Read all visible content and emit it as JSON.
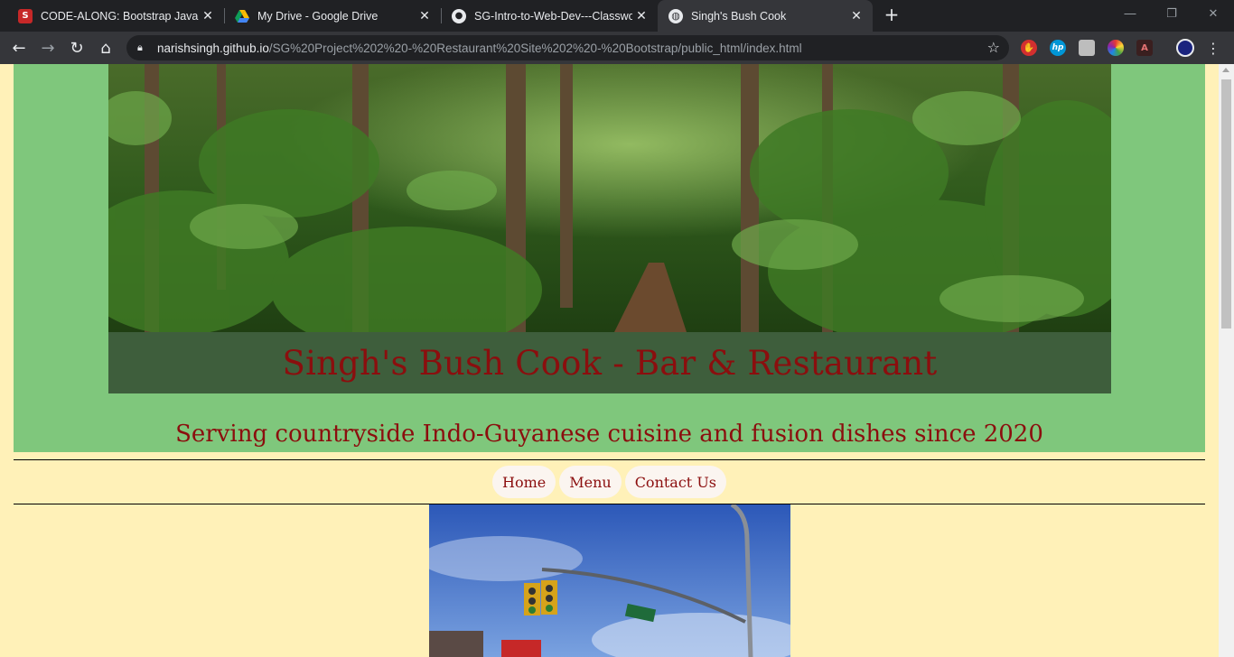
{
  "browser": {
    "tabs": [
      {
        "title": "CODE-ALONG: Bootstrap JavaScri",
        "favicon": "code-along-icon",
        "active": false
      },
      {
        "title": "My Drive - Google Drive",
        "favicon": "google-drive-icon",
        "active": false
      },
      {
        "title": "SG-Intro-to-Web-Dev---Classwor",
        "favicon": "github-icon",
        "active": false
      },
      {
        "title": "Singh's Bush Cook",
        "favicon": "globe-icon",
        "active": true
      }
    ],
    "url_host": "narishsingh.github.io",
    "url_path": "/SG%20Project%202%20-%20Restaurant%20Site%202%20-%20Bootstrap/public_html/index.html",
    "extensions": [
      "adblock-icon",
      "hp-icon",
      "cube-icon",
      "color-wheel-icon",
      "pdf-icon",
      "profile-avatar"
    ]
  },
  "page": {
    "restaurant_name": "Singh's Bush Cook - Bar & Restaurant",
    "tagline": "Serving countryside Indo-Guyanese cuisine and fusion dishes since 2020",
    "nav": [
      {
        "label": "Home"
      },
      {
        "label": "Menu"
      },
      {
        "label": "Contact Us"
      }
    ]
  },
  "colors": {
    "page_bg": "#fff1b8",
    "green_band": "#7fc77c",
    "name_bar": "#3e5e3c",
    "accent_text": "#8b0e0e"
  }
}
